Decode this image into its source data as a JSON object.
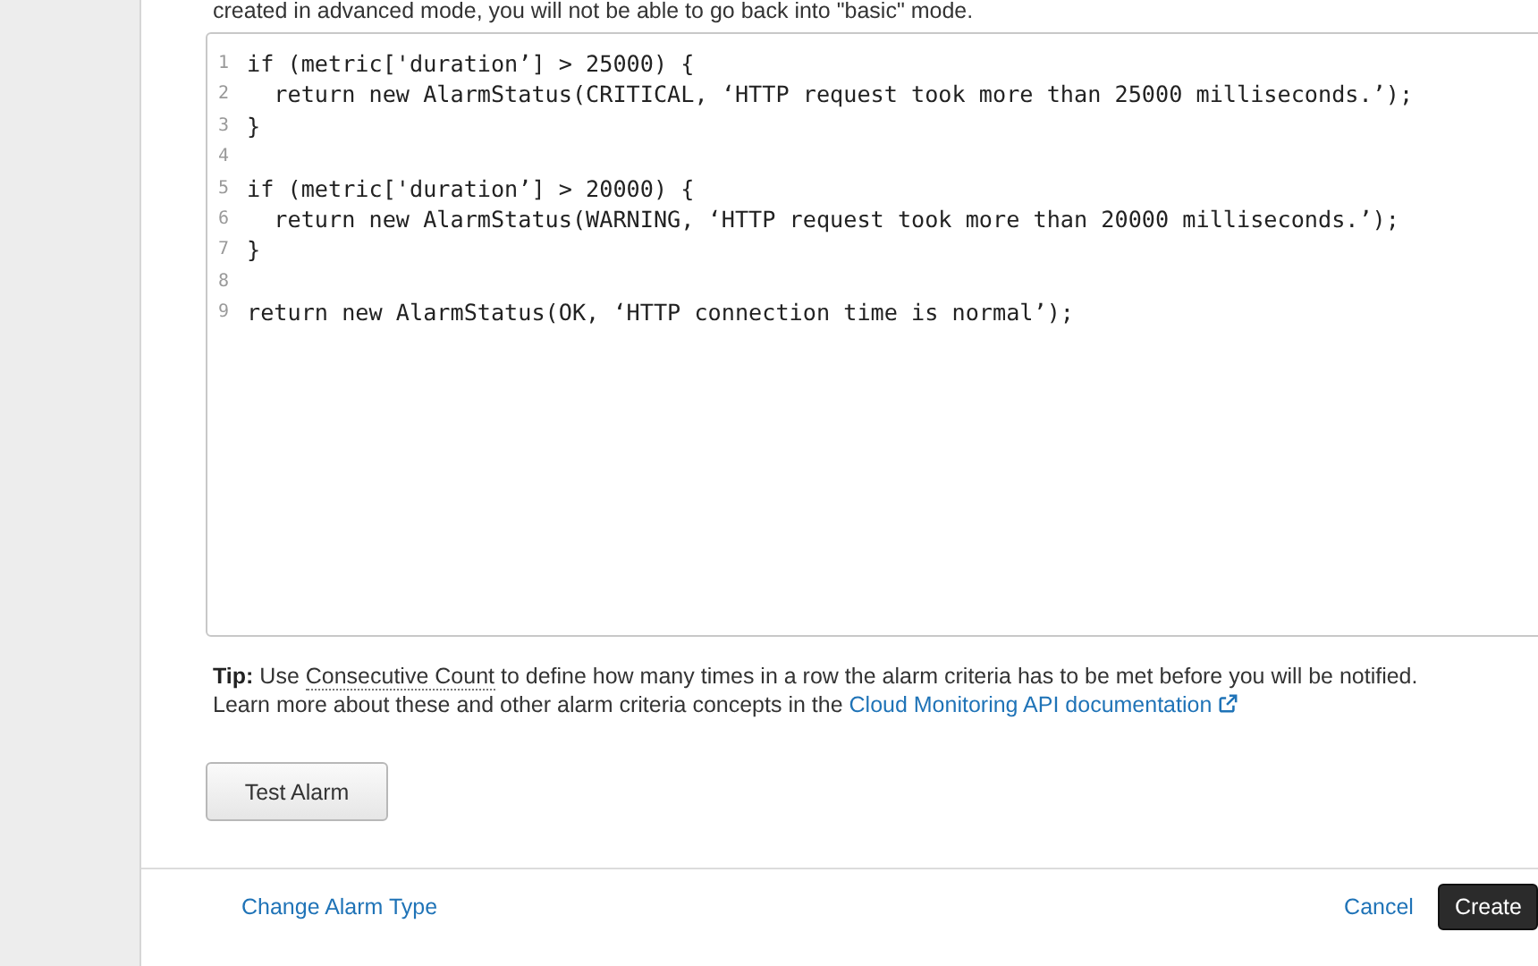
{
  "intro_text": "created in advanced mode, you will not be able to go back into \"basic\" mode.",
  "code_editor": {
    "lines": [
      {
        "number": "1",
        "text": "if (metric['duration’] > 25000) {"
      },
      {
        "number": "2",
        "text": "  return new AlarmStatus(CRITICAL, ‘HTTP request took more than 25000 milliseconds.’);"
      },
      {
        "number": "3",
        "text": "}"
      },
      {
        "number": "4"
      },
      {
        "number": "5",
        "text": "if (metric['duration’] > 20000) {"
      },
      {
        "number": "6",
        "text": "  return new AlarmStatus(WARNING, ‘HTTP request took more than 20000 milliseconds.’);"
      },
      {
        "number": "7",
        "text": "}"
      },
      {
        "number": "8"
      },
      {
        "number": "9",
        "text": "return new AlarmStatus(OK, ‘HTTP connection time is normal’);"
      }
    ]
  },
  "tip": {
    "label": "Tip:",
    "before": "Use",
    "term": "Consecutive Count",
    "after": "to define how many times in a row the alarm criteria has to be met before you will be notified.",
    "line2": "Learn more about these and other alarm criteria concepts in the",
    "link": "Cloud Monitoring API documentation"
  },
  "test_button": "Test Alarm",
  "footer": {
    "change_link": "Change Alarm Type",
    "cancel_link": "Cancel",
    "create_button": "Create"
  }
}
